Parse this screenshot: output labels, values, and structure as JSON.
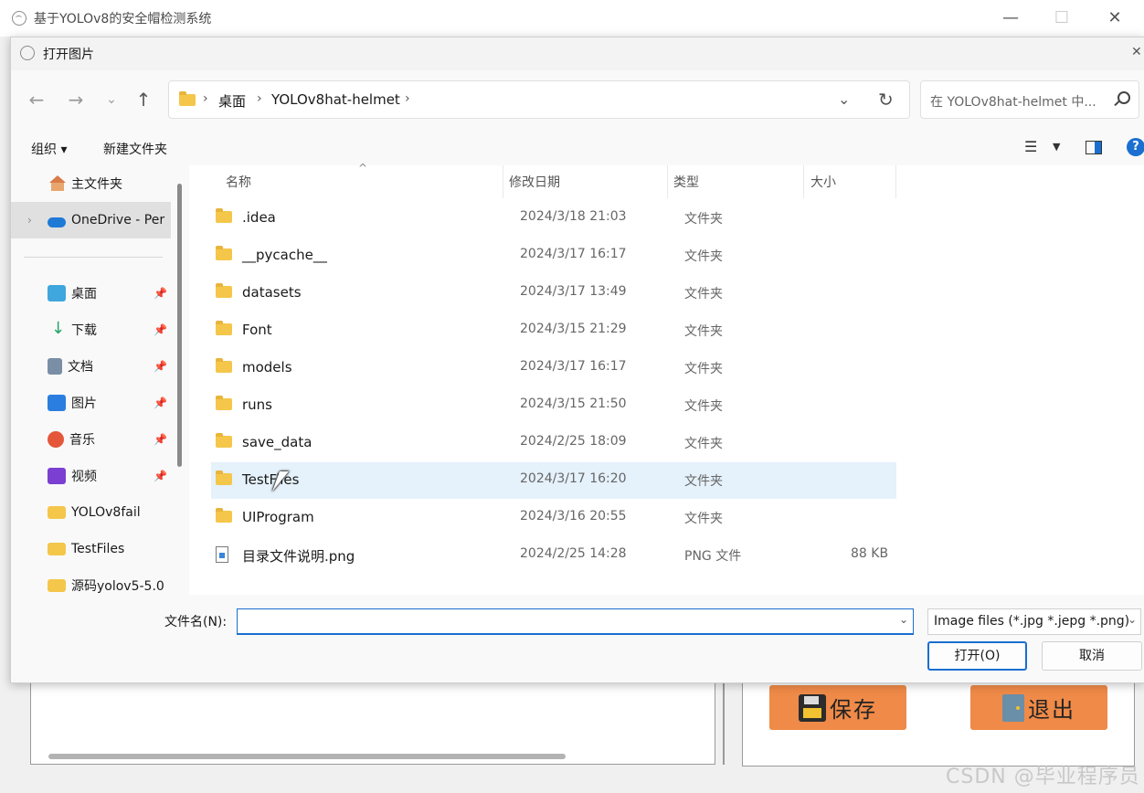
{
  "app": {
    "title": "基于YOLOv8的安全帽检测系统",
    "minimize": "—",
    "maximize": "☐",
    "close": "✕",
    "save_label": "保存",
    "exit_label": "退出",
    "watermark": "CSDN @毕业程序员"
  },
  "dialog": {
    "title": "打开图片",
    "close": "✕",
    "address": {
      "crumbs": [
        "桌面",
        "YOLOv8hat-helmet"
      ],
      "sep": "›"
    },
    "search_placeholder": "在 YOLOv8hat-helmet 中...",
    "commands": {
      "organize": "组织 ▾",
      "new_folder": "新建文件夹"
    },
    "nav": {
      "back": "←",
      "forward": "→",
      "recent": "⌄",
      "up": "↑",
      "dropdown": "⌄",
      "refresh": "↻",
      "view_menu": "☰",
      "view_caret": "▼",
      "help": "?"
    },
    "sidebar": {
      "items": [
        {
          "label": "主文件夹",
          "icon": "home-icon"
        },
        {
          "label": "OneDrive - Per",
          "icon": "cloud-icon"
        },
        {
          "label": "桌面",
          "icon": "desktop-icon",
          "pinned": true
        },
        {
          "label": "下载",
          "icon": "download-icon",
          "pinned": true
        },
        {
          "label": "文档",
          "icon": "documents-icon",
          "pinned": true
        },
        {
          "label": "图片",
          "icon": "pictures-icon",
          "pinned": true
        },
        {
          "label": "音乐",
          "icon": "music-icon",
          "pinned": true
        },
        {
          "label": "视频",
          "icon": "videos-icon",
          "pinned": true
        },
        {
          "label": "YOLOv8fail",
          "icon": "folder-icon"
        },
        {
          "label": "TestFiles",
          "icon": "folder-icon"
        },
        {
          "label": "源码yolov5-5.0",
          "icon": "folder-icon"
        }
      ],
      "pin_glyph": "📌",
      "expander_glyph": "›"
    },
    "columns": {
      "name": "名称",
      "modified": "修改日期",
      "type": "类型",
      "size": "大小",
      "sort_glyph": "^"
    },
    "files": [
      {
        "name": ".idea",
        "modified": "2024/3/18 21:03",
        "type": "文件夹",
        "size": ""
      },
      {
        "name": "__pycache__",
        "modified": "2024/3/17 16:17",
        "type": "文件夹",
        "size": ""
      },
      {
        "name": "datasets",
        "modified": "2024/3/17 13:49",
        "type": "文件夹",
        "size": ""
      },
      {
        "name": "Font",
        "modified": "2024/3/15 21:29",
        "type": "文件夹",
        "size": ""
      },
      {
        "name": "models",
        "modified": "2024/3/17 16:17",
        "type": "文件夹",
        "size": ""
      },
      {
        "name": "runs",
        "modified": "2024/3/15 21:50",
        "type": "文件夹",
        "size": ""
      },
      {
        "name": "save_data",
        "modified": "2024/2/25 18:09",
        "type": "文件夹",
        "size": ""
      },
      {
        "name": "TestFiles",
        "modified": "2024/3/17 16:20",
        "type": "文件夹",
        "size": ""
      },
      {
        "name": "UIProgram",
        "modified": "2024/3/16 20:55",
        "type": "文件夹",
        "size": ""
      },
      {
        "name": "目录文件说明.png",
        "modified": "2024/2/25 14:28",
        "type": "PNG 文件",
        "size": "88 KB"
      }
    ],
    "filename_label": "文件名(N):",
    "filename_value": "",
    "filename_caret": "⌄",
    "filetype": "Image files (*.jpg *.jepg *.png)",
    "filetype_caret": "⌄",
    "open_button": "打开(O)",
    "cancel_button": "取消"
  },
  "colors": {
    "accent": "#1a6fd0",
    "app_button": "#ef8a48",
    "hover_row": "#e5f1fb"
  }
}
